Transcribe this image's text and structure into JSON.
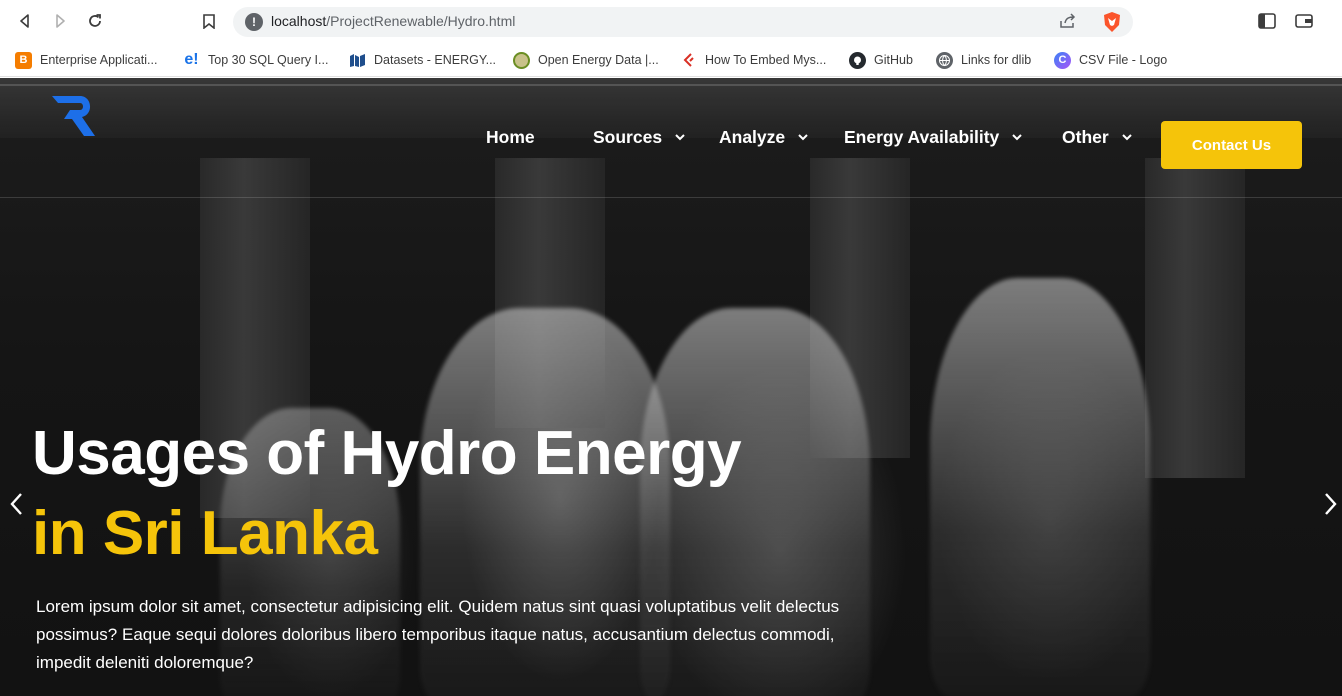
{
  "browser": {
    "url_host": "localhost",
    "url_path": "/ProjectRenewable/Hydro.html",
    "icons": {
      "back": "back-arrow-icon",
      "forward": "forward-arrow-icon",
      "reload": "reload-icon",
      "bookmark": "bookmark-icon",
      "site_info": "info-icon",
      "share": "share-icon",
      "brave": "brave-shield-icon",
      "sidebar": "sidebar-icon",
      "wallet": "wallet-icon"
    },
    "bookmarks": [
      {
        "label": "Enterprise Applicati...",
        "icon": "blogger-icon",
        "color": "#f57d00"
      },
      {
        "label": "Top 30 SQL Query I...",
        "icon": "e-icon",
        "color": "#1a73e8"
      },
      {
        "label": "Datasets - ENERGY...",
        "icon": "datasets-icon",
        "color": "#1f4e8c"
      },
      {
        "label": "Open Energy Data |...",
        "icon": "energy-seal-icon",
        "color": "#6b8e23"
      },
      {
        "label": "How To Embed Mys...",
        "icon": "embed-icon",
        "color": "#d93025"
      },
      {
        "label": "GitHub",
        "icon": "github-icon",
        "color": "#24292e"
      },
      {
        "label": "Links for dlib",
        "icon": "globe-icon",
        "color": "#5f6368"
      },
      {
        "label": "CSV File - Logo",
        "icon": "csv-logo-icon",
        "color": "#3b82f6"
      }
    ]
  },
  "site": {
    "logo_icon": "r-logo-icon",
    "nav": [
      {
        "label": "Home",
        "has_dropdown": false
      },
      {
        "label": "Sources",
        "has_dropdown": true
      },
      {
        "label": "Analyze",
        "has_dropdown": true
      },
      {
        "label": "Energy Availability",
        "has_dropdown": true
      },
      {
        "label": "Other",
        "has_dropdown": true
      }
    ],
    "cta_label": "Contact Us",
    "accent": "#f5c40a",
    "logo_color": "#1d6fe8"
  },
  "hero": {
    "title_line1": "Usages of Hydro Energy",
    "title_line2": "in Sri Lanka",
    "lede": "Lorem ipsum dolor sit amet, consectetur adipisicing elit. Quidem natus sint quasi voluptatibus velit delectus possimus? Eaque sequi dolores doloribus libero temporibus itaque natus, accusantium delectus commodi, impedit deleniti doloremque?",
    "prev_icon": "chevron-left-icon",
    "next_icon": "chevron-right-icon"
  }
}
